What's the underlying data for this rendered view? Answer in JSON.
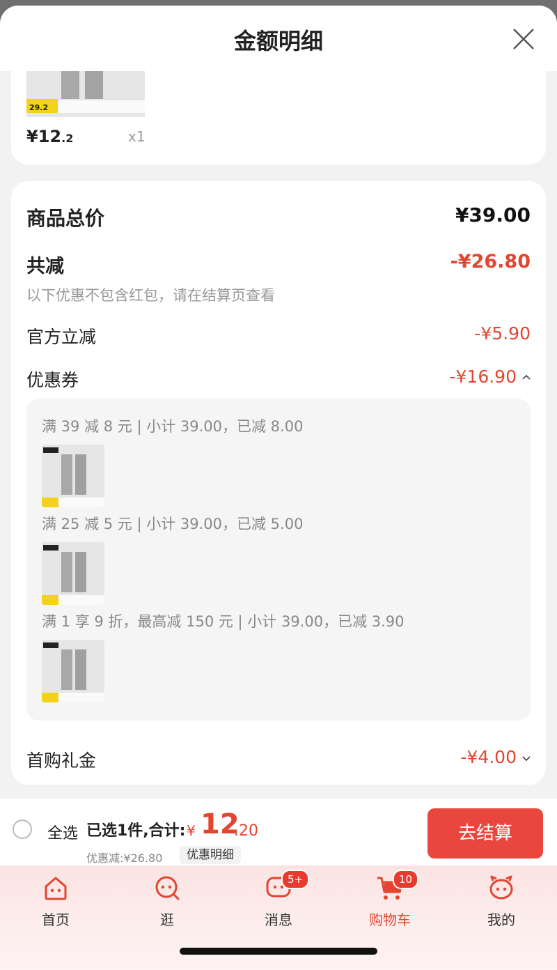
{
  "header": {
    "title": "金额明细"
  },
  "item": {
    "price_symbol": "¥",
    "price_int": "12",
    "price_dec": ".2",
    "quantity": "x1",
    "thumb_tag": "29.2"
  },
  "summary": {
    "total_label": "商品总价",
    "total_value": "¥39.00",
    "reduce_label": "共减",
    "reduce_value": "-¥26.80",
    "reduce_note": "以下优惠不包含红包，请在结算页查看",
    "official_label": "官方立减",
    "official_value": "-¥5.90",
    "coupon_label": "优惠券",
    "coupon_value": "-¥16.90",
    "coupon_lines": [
      "满 39 减 8 元 | 小计 39.00，已减 8.00",
      "满 25 减 5 元 | 小计 39.00，已减 5.00",
      "满 1 享 9 折，最高减 150 元 | 小计 39.00，已减 3.90"
    ],
    "gift_label": "首购礼金",
    "gift_value": "-¥4.00"
  },
  "bottom": {
    "select_all": "全选",
    "selected_text": "已选1件,合计:",
    "total_symbol": "¥",
    "total_int": "12",
    "total_dec": ".20",
    "discount_text": "优惠减:¥26.80",
    "detail_chip": "优惠明细",
    "checkout": "去结算"
  },
  "tabs": [
    {
      "label": "首页",
      "badge": ""
    },
    {
      "label": "逛",
      "badge": ""
    },
    {
      "label": "消息",
      "badge": "5+"
    },
    {
      "label": "购物车",
      "badge": "10"
    },
    {
      "label": "我的",
      "badge": ""
    }
  ],
  "colors": {
    "accent": "#e2462f",
    "button": "#e9463d"
  }
}
